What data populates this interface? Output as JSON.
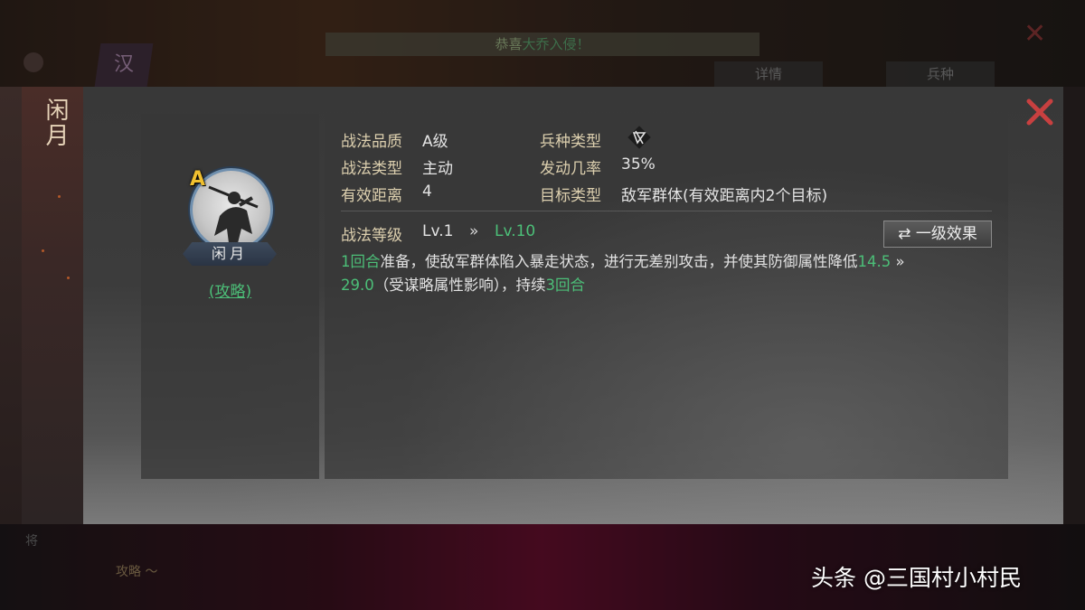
{
  "background": {
    "banner_text": "恭喜",
    "banner_green": "大乔入侵！",
    "emblem_char": "汉",
    "tabs": [
      "详情",
      "兵种"
    ],
    "footer_text": "攻略 ～"
  },
  "dialog": {
    "title": "闲月",
    "hero": {
      "grade": "A",
      "name": "闲月",
      "strategy_link": "(攻略)"
    },
    "attributes": {
      "quality_label": "战法品质",
      "quality_value": "A级",
      "troop_label": "兵种类型",
      "troop_icon": "bow-troop-icon",
      "type_label": "战法类型",
      "type_value": "主动",
      "rate_label": "发动几率",
      "rate_value": "35%",
      "range_label": "有效距离",
      "range_value": "4",
      "target_label": "目标类型",
      "target_value": "敌军群体(有效距离内2个目标)"
    },
    "level": {
      "label": "战法等级",
      "current": "Lv.1",
      "arrow": "»",
      "max": "Lv.10",
      "effect_button": "一级效果"
    },
    "description": {
      "p1_green": "1回合",
      "p1_text": "准备，使敌军群体陷入暴走状态，进行无差别攻击，并使其防御属性降低",
      "p2_green": "14.5",
      "p2_arrow": " » ",
      "p3_green": "29.0",
      "p3_text": "（受谋略属性影响），持续",
      "p4_green": "3回合"
    }
  },
  "watermark": "头条 @三国村小村民",
  "colors": {
    "accent_green": "#4cbf78",
    "label_gold": "#dccfae",
    "close_red": "#c84040",
    "grade_gold": "#f0c030"
  }
}
